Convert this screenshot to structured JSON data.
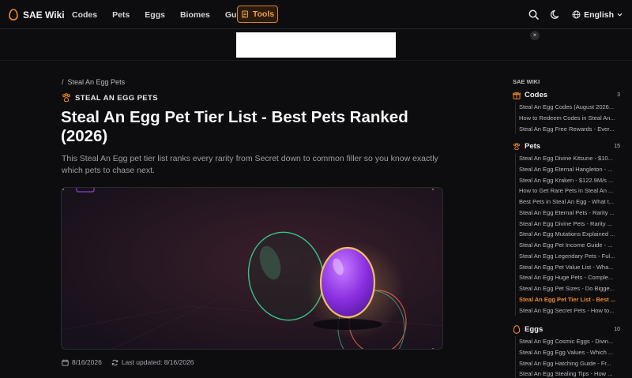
{
  "nav": {
    "brand": "SAE Wiki",
    "links": [
      "Codes",
      "Pets",
      "Eggs",
      "Biomes",
      "Guides"
    ],
    "tools_label": "Tools",
    "language": "English"
  },
  "ad": {
    "close": "×"
  },
  "article": {
    "breadcrumb_sep": "/",
    "breadcrumb": "Steal An Egg Pets",
    "category": "STEAL AN EGG PETS",
    "title": "Steal An Egg Pet Tier List - Best Pets Ranked (2026)",
    "description": "This Steal An Egg pet tier list ranks every rarity from Secret down to common filler so you know exactly which pets to chase next.",
    "published": "8/16/2026",
    "updated": "Last updated: 8/16/2026"
  },
  "sidebar": {
    "title": "SAE WIKI",
    "sections": [
      {
        "label": "Codes",
        "count": "3",
        "items": [
          "Steal An Egg Codes (August 2026...",
          "How to Redeem Codes in Steal An...",
          "Steal An Egg Free Rewards - Ever..."
        ]
      },
      {
        "label": "Pets",
        "count": "15",
        "items": [
          "Steal An Egg Divine Kitsune - $10...",
          "Steal An Egg Eternal Hangleton - ...",
          "Steal An Egg Kraken - $122.9M/s ...",
          "How to Get Rare Pets in Steal An ...",
          "Best Pets in Steal An Egg - What t...",
          "Steal An Egg Eternal Pets - Rarity ...",
          "Steal An Egg Divine Pets - Rarity ...",
          "Steal An Egg Mutations Explained ...",
          "Steal An Egg Pet Income Guide - ...",
          "Steal An Egg Legendary Pets - Ful...",
          "Steal An Egg Pet Value List - Wha...",
          "Steal An Egg Huge Pets - Comple...",
          "Steal An Egg Pet Sizes - Do Bigge...",
          "Steal An Egg Pet Tier List - Best ...",
          "Steal An Egg Secret Pets - How to..."
        ],
        "active_index": 13
      },
      {
        "label": "Eggs",
        "count": "10",
        "items": [
          "Steal An Egg Cosmic Eggs - Divin...",
          "Steal An Egg Egg Values - Which ...",
          "Steal An Egg Hatching Guide - Fr...",
          "Steal An Egg Stealing Tips - How ..."
        ]
      }
    ]
  },
  "colors": {
    "accent": "#f08a28",
    "background": "#0d0d10"
  },
  "icons": [
    "egg-logo-icon",
    "tools-icon",
    "search-icon",
    "moon-icon",
    "globe-icon",
    "chevron-down-icon",
    "paw-icon",
    "gift-icon",
    "egg-icon",
    "calendar-icon",
    "refresh-icon"
  ]
}
